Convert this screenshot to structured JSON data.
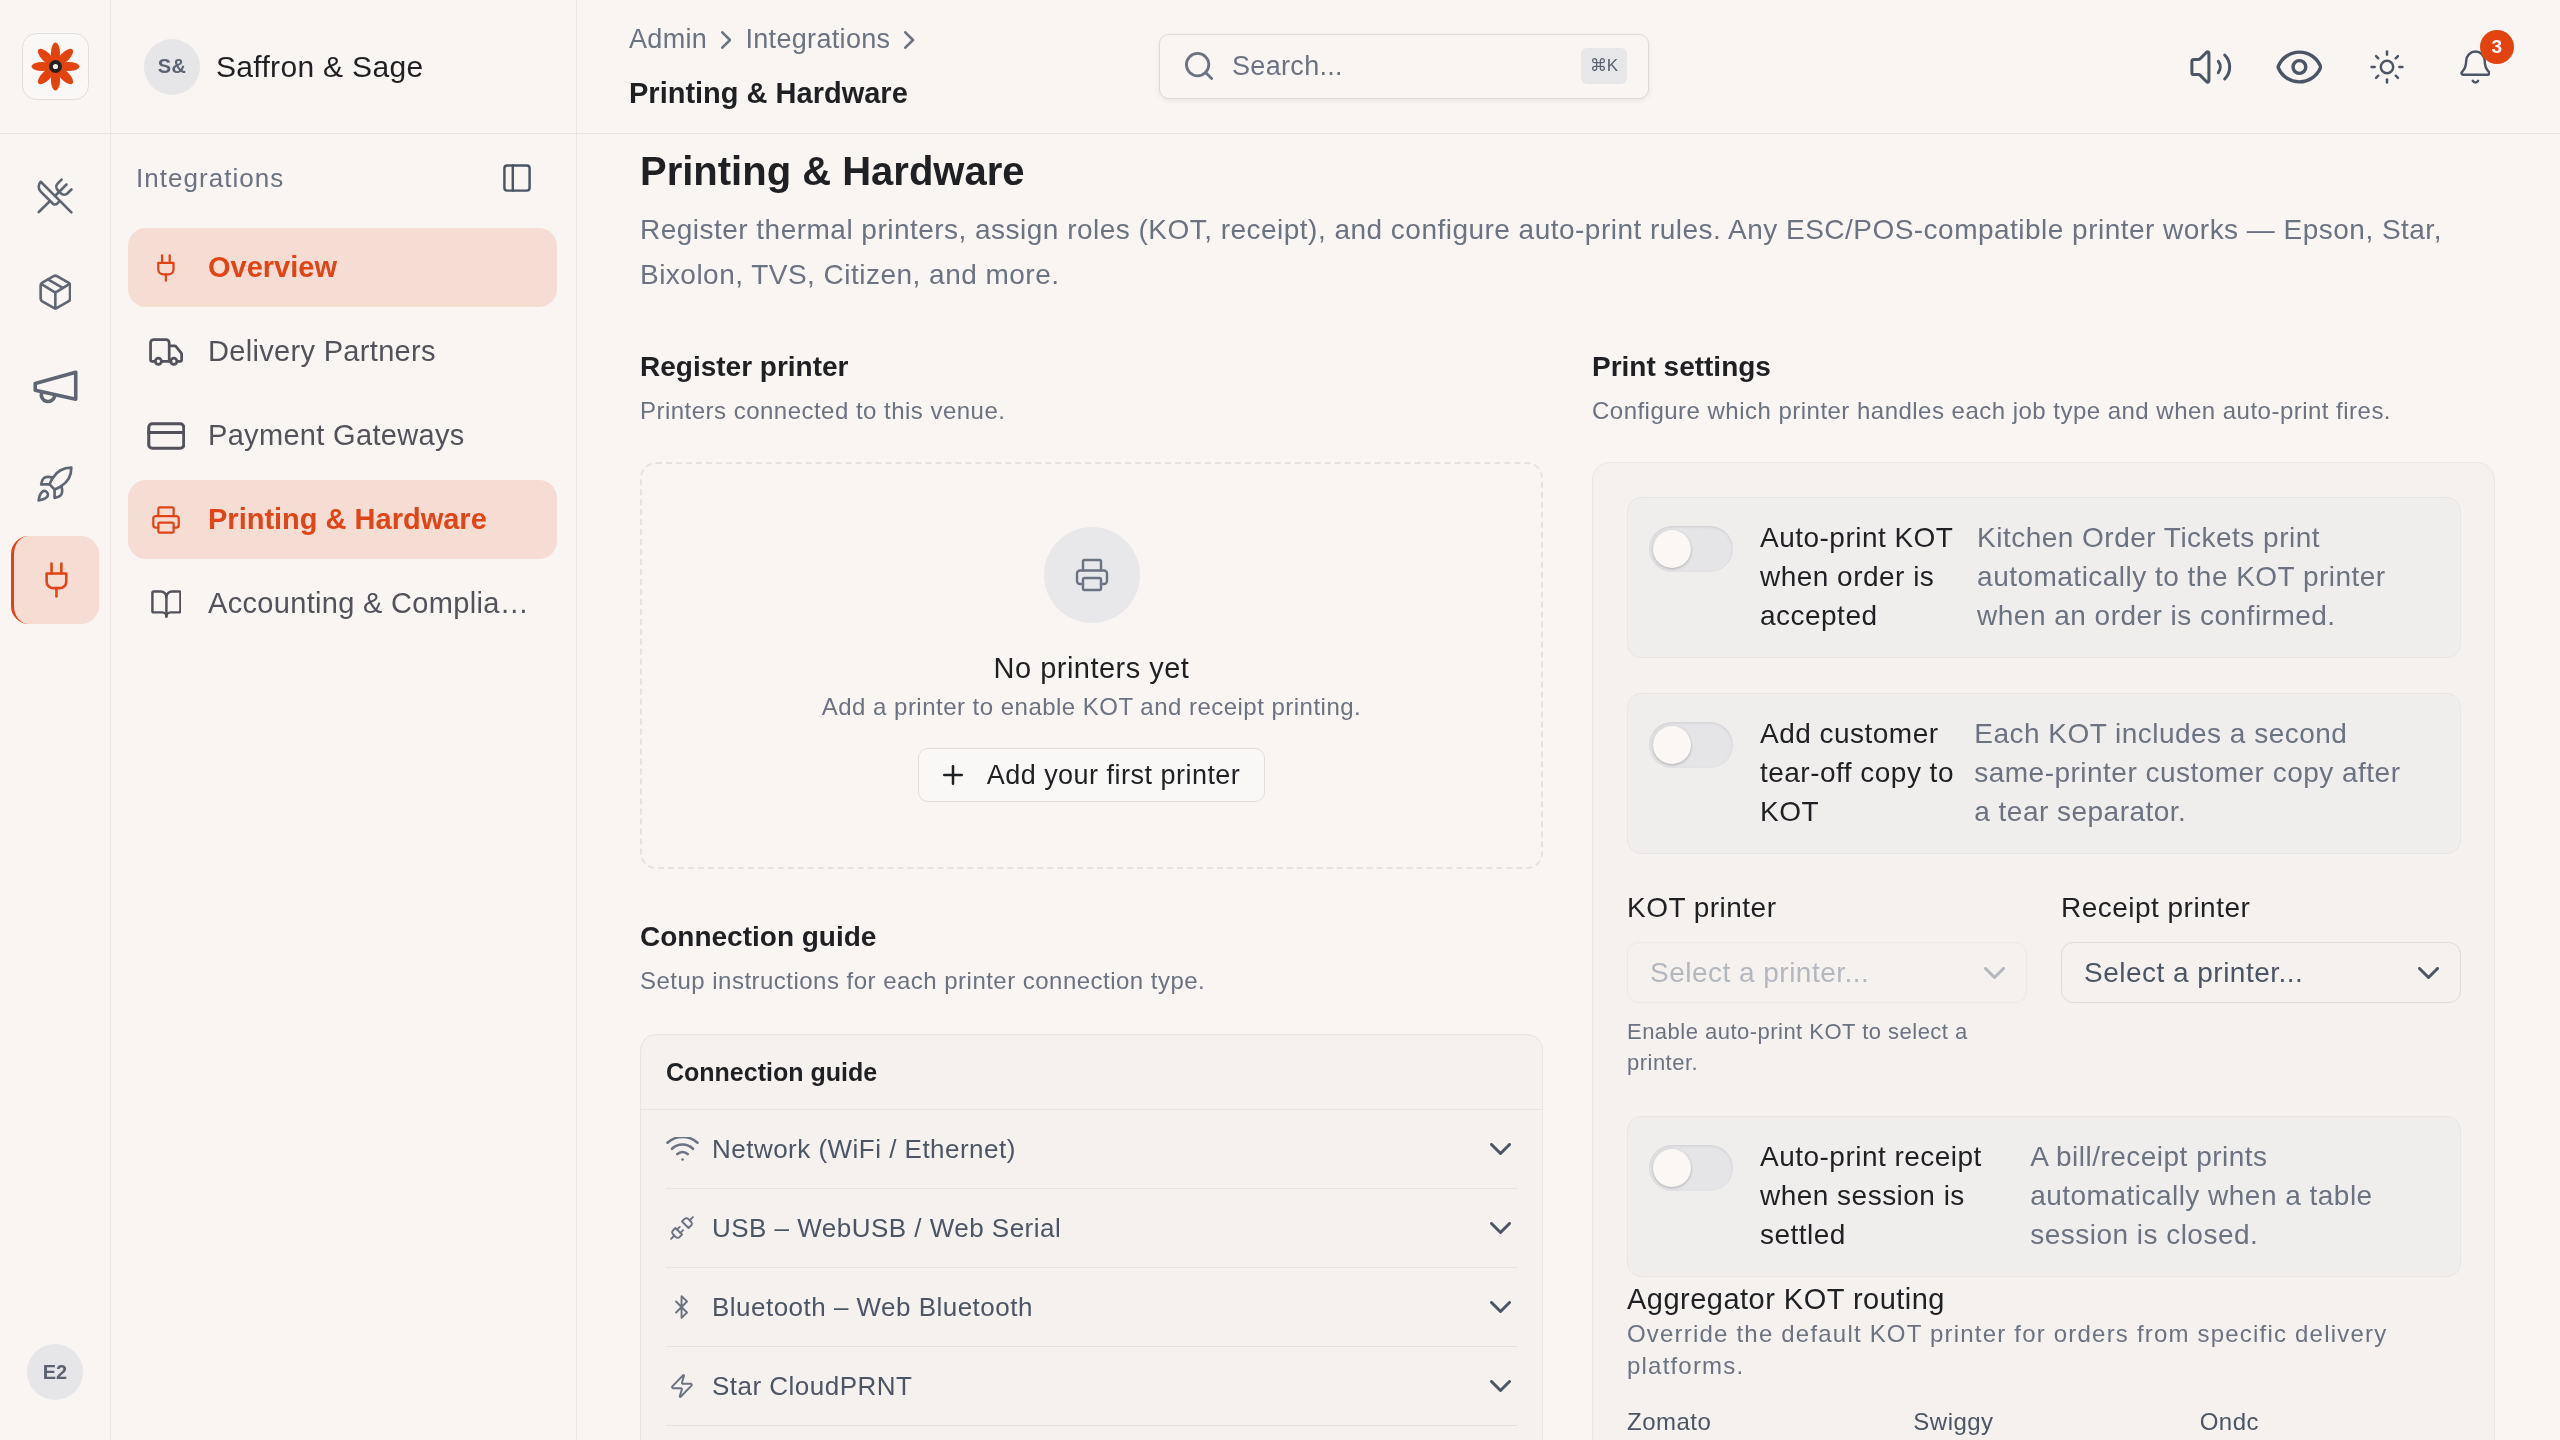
{
  "brand": {
    "initials": "S&",
    "name": "Saffron & Sage"
  },
  "rail": {
    "items": [
      {
        "selected": false
      },
      {
        "selected": false
      },
      {
        "selected": false
      },
      {
        "selected": false
      },
      {
        "selected": true
      }
    ],
    "user_initials": "E2"
  },
  "sidebar": {
    "title": "Integrations",
    "items": [
      {
        "label": "Overview",
        "selected": true
      },
      {
        "label": "Delivery Partners",
        "selected": false
      },
      {
        "label": "Payment Gateways",
        "selected": false
      },
      {
        "label": "Printing & Hardware",
        "selected": true
      },
      {
        "label": "Accounting & Complia…",
        "selected": false
      }
    ]
  },
  "header": {
    "breadcrumb": [
      "Admin",
      "Integrations"
    ],
    "current": "Printing & Hardware",
    "search": {
      "placeholder": "Search...",
      "shortcut": "⌘K"
    },
    "notification_count": "3"
  },
  "page": {
    "title": "Printing & Hardware",
    "description": "Register thermal printers, assign roles (KOT, receipt), and configure auto-print rules. Any ESC/POS-compatible printer works — Epson, Star, Bixolon, TVS, Citizen, and more."
  },
  "register": {
    "title": "Register printer",
    "subtitle": "Printers connected to this venue.",
    "empty_title": "No printers yet",
    "empty_text": "Add a printer to enable KOT and receipt printing.",
    "button": "Add your first printer"
  },
  "guide": {
    "title": "Connection guide",
    "subtitle": "Setup instructions for each printer connection type.",
    "card_title": "Connection guide",
    "items": [
      {
        "label": "Network (WiFi / Ethernet)",
        "expanded": false
      },
      {
        "label": "USB – WebUSB / Web Serial",
        "expanded": false
      },
      {
        "label": "Bluetooth – Web Bluetooth",
        "expanded": false
      },
      {
        "label": "Star CloudPRNT",
        "expanded": false
      }
    ]
  },
  "settings": {
    "title": "Print settings",
    "subtitle": "Configure which printer handles each job type and when auto-print fires.",
    "toggles": [
      {
        "label": "Auto-print KOT when order is accepted",
        "description": "Kitchen Order Tickets print automatically to the KOT printer when an order is confirmed.",
        "on": false
      },
      {
        "label": "Add customer tear-off copy to KOT",
        "description": "Each KOT includes a second same-printer customer copy after a tear separator.",
        "on": false
      }
    ],
    "printers": [
      {
        "label": "KOT printer",
        "placeholder": "Select a printer...",
        "disabled": true,
        "hint": "Enable auto-print KOT to select a printer."
      },
      {
        "label": "Receipt printer",
        "placeholder": "Select a printer...",
        "disabled": false
      }
    ],
    "receipt_toggle": {
      "label": "Auto-print receipt when session is settled",
      "description": "A bill/receipt prints automatically when a table session is closed.",
      "on": false
    },
    "aggregator": {
      "title": "Aggregator KOT routing",
      "description": "Override the default KOT printer for orders from specific delivery platforms.",
      "platforms": [
        "Zomato",
        "Swiggy",
        "Ondc"
      ]
    }
  }
}
